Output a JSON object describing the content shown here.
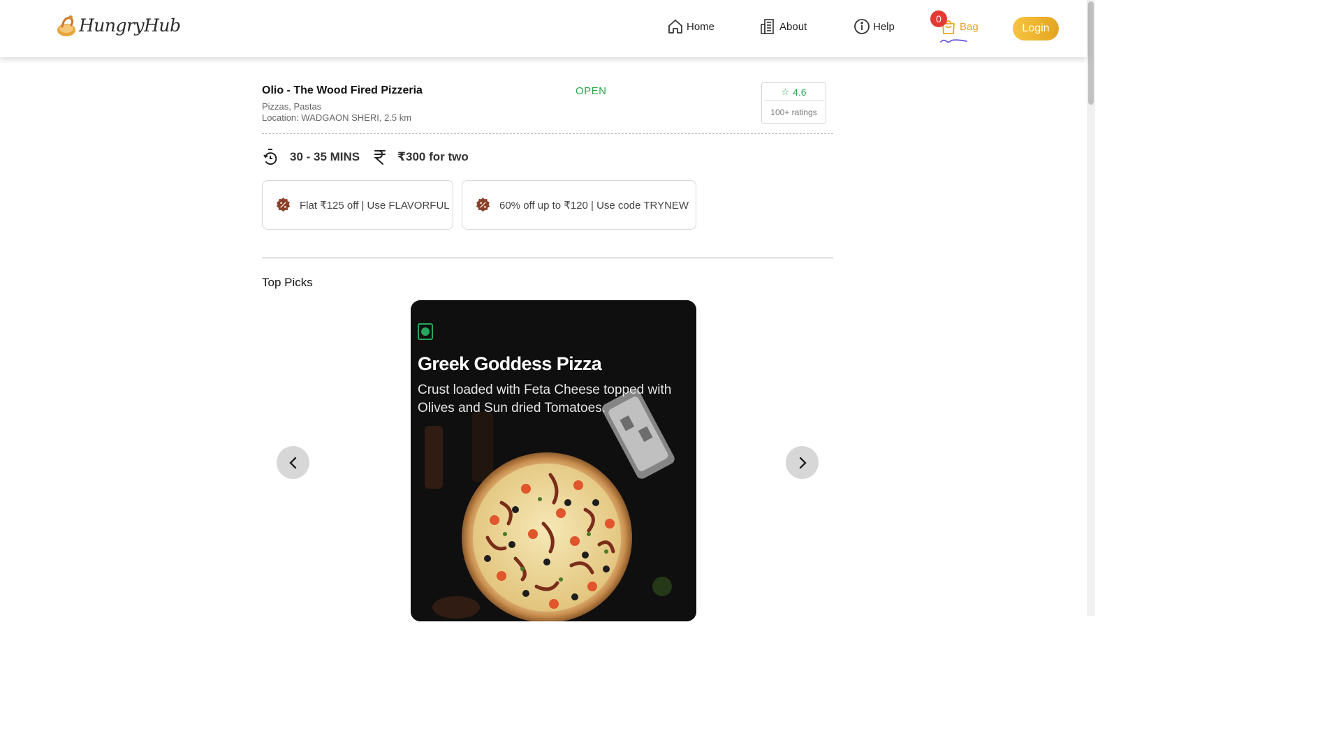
{
  "header": {
    "logo_text": "HungryHub",
    "nav": {
      "home": "Home",
      "about": "About",
      "help": "Help",
      "bag": "Bag",
      "bag_count": "0"
    },
    "login_label": "Login",
    "accent_color": "#e8a525",
    "badge_color": "#e53935"
  },
  "restaurant": {
    "name": "Olio - The Wood Fired Pizzeria",
    "cuisines": "Pizzas, Pastas",
    "location": "Location: WADGAON SHERI, 2.5 km",
    "status": "OPEN",
    "status_color": "#2aa64c",
    "rating": "4.6",
    "ratings_count": "100+ ratings",
    "delivery_time": "30 - 35 MINS",
    "cost_for_two": "₹300 for two"
  },
  "offers": [
    {
      "text": "Flat ₹125 off | Use FLAVORFUL",
      "icon": "discount-badge-icon"
    },
    {
      "text": "60% off up to ₹120 | Use code TRYNEW",
      "icon": "discount-badge-icon"
    }
  ],
  "top_picks": {
    "title": "Top Picks",
    "items": [
      {
        "name": "Greek Goddess Pizza",
        "description": "Crust loaded with Feta Cheese topped with Olives and Sun dried Tomatoes.",
        "veg": true
      }
    ]
  },
  "icons": {
    "home": "home-icon",
    "about": "building-icon",
    "help": "info-icon",
    "bag": "shopping-bag-icon",
    "timer": "timer-icon",
    "rupee": "rupee-icon",
    "prev": "chevron-left-icon",
    "next": "chevron-right-icon"
  }
}
